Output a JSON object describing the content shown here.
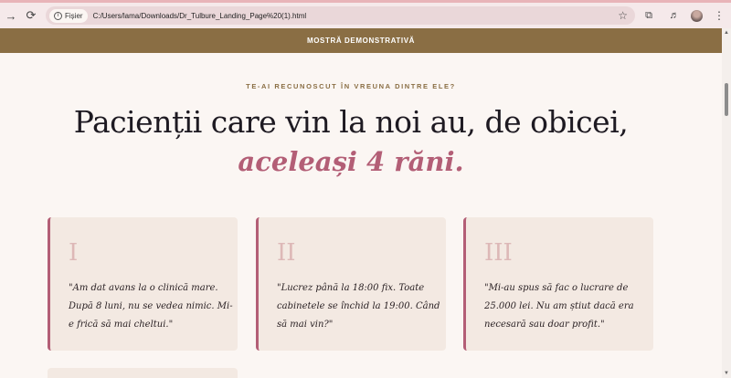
{
  "browser": {
    "site_chip": "Fișier",
    "url": "C:/Users/lama/Downloads/Dr_Tulbure_Landing_Page%20(1).html"
  },
  "banner": {
    "text": "MOSTRĂ DEMONSTRATIVĂ"
  },
  "section": {
    "eyebrow": "TE-AI RECUNOSCUT ÎN VREUNA DINTRE ELE?",
    "title_line1": "Pacienții care vin la noi au, de obicei,",
    "title_line2": "aceleași 4 răni."
  },
  "cards": [
    {
      "numeral": "I",
      "quote": "\"Am dat avans la o clinică mare. După 8 luni, nu se vedea nimic. Mi-e frică să mai cheltui.\""
    },
    {
      "numeral": "II",
      "quote": "\"Lucrez până la 18:00 fix. Toate cabinetele se închid la 19:00. Când să mai vin?\""
    },
    {
      "numeral": "III",
      "quote": "\"Mi-au spus să fac o lucrare de 25.000 lei. Nu am știut dacă era necesară sau doar profit.\""
    }
  ],
  "colors": {
    "accent": "#b35e76",
    "banner": "#8a6e44",
    "card_bg": "#f3e9e2",
    "page_bg": "#fbf6f3"
  }
}
